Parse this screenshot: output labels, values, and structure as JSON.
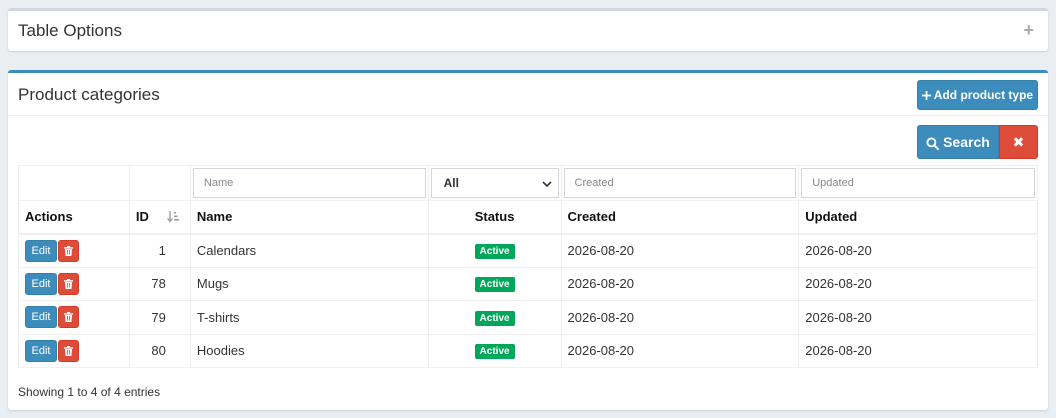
{
  "options": {
    "title": "Table Options",
    "toggle_icon": "+"
  },
  "panel": {
    "title": "Product categories",
    "add_label": "Add product type",
    "search_label": "Search",
    "clear_icon": "✖"
  },
  "filters": {
    "name_placeholder": "Name",
    "status_value": "All",
    "created_placeholder": "Created",
    "updated_placeholder": "Updated"
  },
  "columns": {
    "actions": "Actions",
    "id": "ID",
    "name": "Name",
    "status": "Status",
    "created": "Created",
    "updated": "Updated"
  },
  "row_actions": {
    "edit": "Edit"
  },
  "rows": [
    {
      "id": "1",
      "name": "Calendars",
      "status": "Active",
      "created": "2026-08-20",
      "updated": "2026-08-20"
    },
    {
      "id": "78",
      "name": "Mugs",
      "status": "Active",
      "created": "2026-08-20",
      "updated": "2026-08-20"
    },
    {
      "id": "79",
      "name": "T-shirts",
      "status": "Active",
      "created": "2026-08-20",
      "updated": "2026-08-20"
    },
    {
      "id": "80",
      "name": "Hoodies",
      "status": "Active",
      "created": "2026-08-20",
      "updated": "2026-08-20"
    }
  ],
  "footer": {
    "info": "Showing 1 to 4 of 4 entries"
  },
  "colors": {
    "primary": "#3c8dbc",
    "danger": "#dd4b39",
    "success": "#00a65a"
  }
}
